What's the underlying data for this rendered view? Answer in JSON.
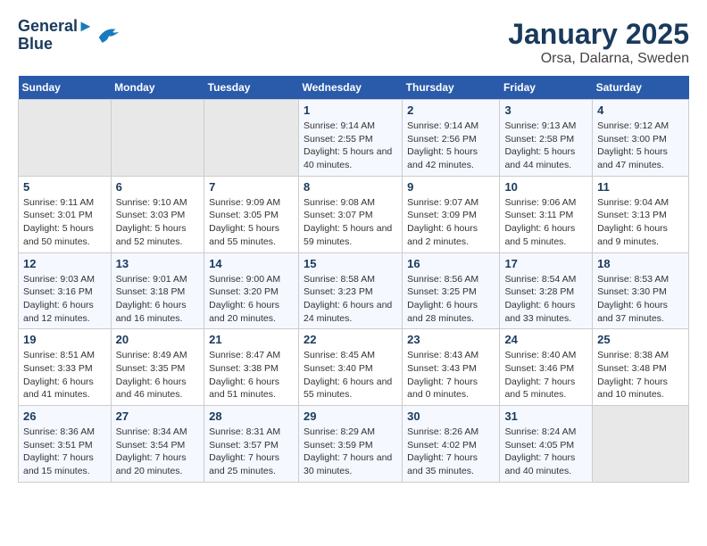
{
  "header": {
    "logo_line1": "General",
    "logo_line2": "Blue",
    "title": "January 2025",
    "subtitle": "Orsa, Dalarna, Sweden"
  },
  "weekdays": [
    "Sunday",
    "Monday",
    "Tuesday",
    "Wednesday",
    "Thursday",
    "Friday",
    "Saturday"
  ],
  "weeks": [
    [
      {
        "day": "",
        "empty": true
      },
      {
        "day": "",
        "empty": true
      },
      {
        "day": "",
        "empty": true
      },
      {
        "day": "1",
        "sunrise": "9:14 AM",
        "sunset": "2:55 PM",
        "daylight": "5 hours and 40 minutes."
      },
      {
        "day": "2",
        "sunrise": "9:14 AM",
        "sunset": "2:56 PM",
        "daylight": "5 hours and 42 minutes."
      },
      {
        "day": "3",
        "sunrise": "9:13 AM",
        "sunset": "2:58 PM",
        "daylight": "5 hours and 44 minutes."
      },
      {
        "day": "4",
        "sunrise": "9:12 AM",
        "sunset": "3:00 PM",
        "daylight": "5 hours and 47 minutes."
      }
    ],
    [
      {
        "day": "5",
        "sunrise": "9:11 AM",
        "sunset": "3:01 PM",
        "daylight": "5 hours and 50 minutes."
      },
      {
        "day": "6",
        "sunrise": "9:10 AM",
        "sunset": "3:03 PM",
        "daylight": "5 hours and 52 minutes."
      },
      {
        "day": "7",
        "sunrise": "9:09 AM",
        "sunset": "3:05 PM",
        "daylight": "5 hours and 55 minutes."
      },
      {
        "day": "8",
        "sunrise": "9:08 AM",
        "sunset": "3:07 PM",
        "daylight": "5 hours and 59 minutes."
      },
      {
        "day": "9",
        "sunrise": "9:07 AM",
        "sunset": "3:09 PM",
        "daylight": "6 hours and 2 minutes."
      },
      {
        "day": "10",
        "sunrise": "9:06 AM",
        "sunset": "3:11 PM",
        "daylight": "6 hours and 5 minutes."
      },
      {
        "day": "11",
        "sunrise": "9:04 AM",
        "sunset": "3:13 PM",
        "daylight": "6 hours and 9 minutes."
      }
    ],
    [
      {
        "day": "12",
        "sunrise": "9:03 AM",
        "sunset": "3:16 PM",
        "daylight": "6 hours and 12 minutes."
      },
      {
        "day": "13",
        "sunrise": "9:01 AM",
        "sunset": "3:18 PM",
        "daylight": "6 hours and 16 minutes."
      },
      {
        "day": "14",
        "sunrise": "9:00 AM",
        "sunset": "3:20 PM",
        "daylight": "6 hours and 20 minutes."
      },
      {
        "day": "15",
        "sunrise": "8:58 AM",
        "sunset": "3:23 PM",
        "daylight": "6 hours and 24 minutes."
      },
      {
        "day": "16",
        "sunrise": "8:56 AM",
        "sunset": "3:25 PM",
        "daylight": "6 hours and 28 minutes."
      },
      {
        "day": "17",
        "sunrise": "8:54 AM",
        "sunset": "3:28 PM",
        "daylight": "6 hours and 33 minutes."
      },
      {
        "day": "18",
        "sunrise": "8:53 AM",
        "sunset": "3:30 PM",
        "daylight": "6 hours and 37 minutes."
      }
    ],
    [
      {
        "day": "19",
        "sunrise": "8:51 AM",
        "sunset": "3:33 PM",
        "daylight": "6 hours and 41 minutes."
      },
      {
        "day": "20",
        "sunrise": "8:49 AM",
        "sunset": "3:35 PM",
        "daylight": "6 hours and 46 minutes."
      },
      {
        "day": "21",
        "sunrise": "8:47 AM",
        "sunset": "3:38 PM",
        "daylight": "6 hours and 51 minutes."
      },
      {
        "day": "22",
        "sunrise": "8:45 AM",
        "sunset": "3:40 PM",
        "daylight": "6 hours and 55 minutes."
      },
      {
        "day": "23",
        "sunrise": "8:43 AM",
        "sunset": "3:43 PM",
        "daylight": "7 hours and 0 minutes."
      },
      {
        "day": "24",
        "sunrise": "8:40 AM",
        "sunset": "3:46 PM",
        "daylight": "7 hours and 5 minutes."
      },
      {
        "day": "25",
        "sunrise": "8:38 AM",
        "sunset": "3:48 PM",
        "daylight": "7 hours and 10 minutes."
      }
    ],
    [
      {
        "day": "26",
        "sunrise": "8:36 AM",
        "sunset": "3:51 PM",
        "daylight": "7 hours and 15 minutes."
      },
      {
        "day": "27",
        "sunrise": "8:34 AM",
        "sunset": "3:54 PM",
        "daylight": "7 hours and 20 minutes."
      },
      {
        "day": "28",
        "sunrise": "8:31 AM",
        "sunset": "3:57 PM",
        "daylight": "7 hours and 25 minutes."
      },
      {
        "day": "29",
        "sunrise": "8:29 AM",
        "sunset": "3:59 PM",
        "daylight": "7 hours and 30 minutes."
      },
      {
        "day": "30",
        "sunrise": "8:26 AM",
        "sunset": "4:02 PM",
        "daylight": "7 hours and 35 minutes."
      },
      {
        "day": "31",
        "sunrise": "8:24 AM",
        "sunset": "4:05 PM",
        "daylight": "7 hours and 40 minutes."
      },
      {
        "day": "",
        "empty": true
      }
    ]
  ]
}
